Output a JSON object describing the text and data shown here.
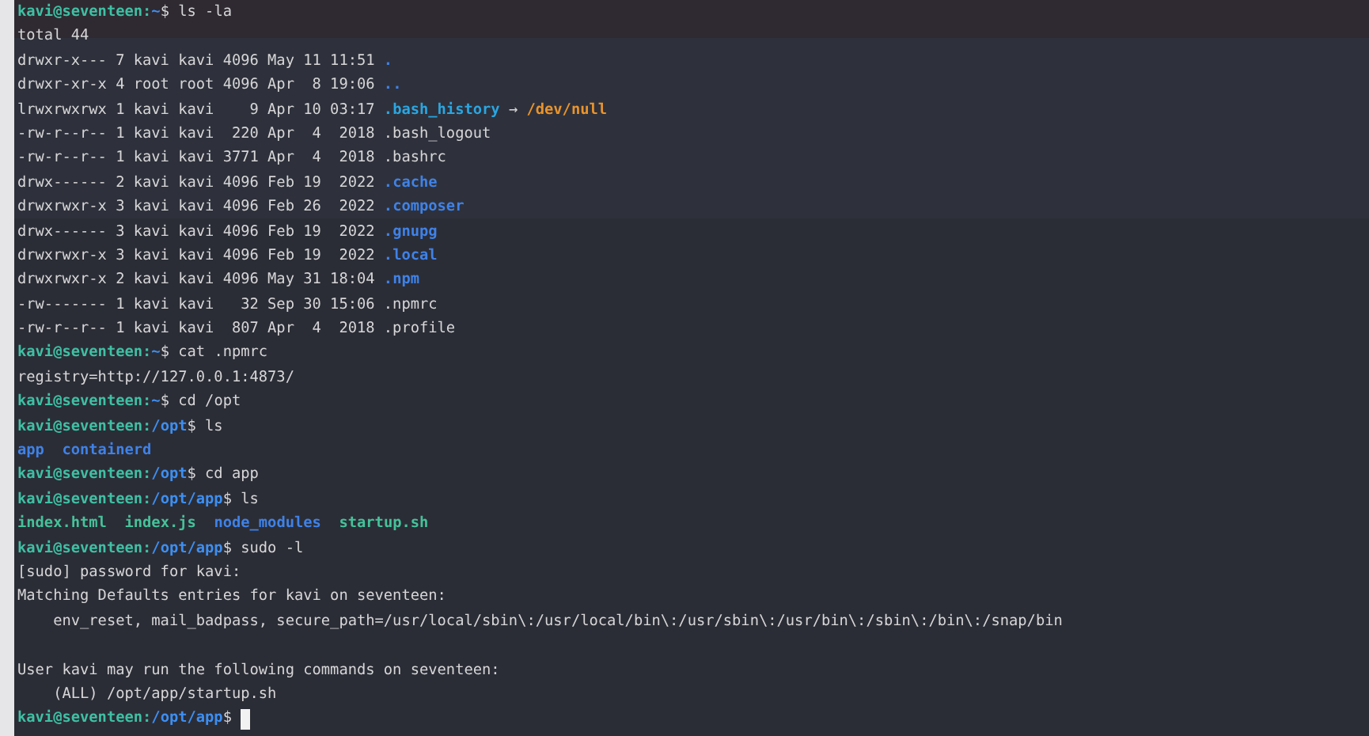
{
  "terminal": {
    "lines": [
      {
        "segments": [
          {
            "kind": "userhost",
            "text": "kavi@seventeen:"
          },
          {
            "kind": "path",
            "text": "~"
          },
          {
            "kind": "plain",
            "text": "$ ls -la"
          }
        ]
      },
      {
        "segments": [
          {
            "kind": "plain",
            "text": "total 44"
          }
        ]
      },
      {
        "segments": [
          {
            "kind": "plain",
            "text": "drwxr-x--- 7 kavi kavi 4096 May 11 11:51 "
          },
          {
            "kind": "dir",
            "text": "."
          }
        ]
      },
      {
        "segments": [
          {
            "kind": "plain",
            "text": "drwxr-xr-x 4 root root 4096 Apr  8 19:06 "
          },
          {
            "kind": "dir",
            "text": ".."
          }
        ]
      },
      {
        "segments": [
          {
            "kind": "plain",
            "text": "lrwxrwxrwx 1 kavi kavi    9 Apr 10 03:17 "
          },
          {
            "kind": "link",
            "text": ".bash_history"
          },
          {
            "kind": "plain",
            "text": " → "
          },
          {
            "kind": "target",
            "text": "/dev/null"
          }
        ]
      },
      {
        "segments": [
          {
            "kind": "plain",
            "text": "-rw-r--r-- 1 kavi kavi  220 Apr  4  2018 .bash_logout"
          }
        ]
      },
      {
        "segments": [
          {
            "kind": "plain",
            "text": "-rw-r--r-- 1 kavi kavi 3771 Apr  4  2018 .bashrc"
          }
        ]
      },
      {
        "segments": [
          {
            "kind": "plain",
            "text": "drwx------ 2 kavi kavi 4096 Feb 19  2022 "
          },
          {
            "kind": "dir",
            "text": ".cache"
          }
        ]
      },
      {
        "segments": [
          {
            "kind": "plain",
            "text": "drwxrwxr-x 3 kavi kavi 4096 Feb 26  2022 "
          },
          {
            "kind": "dir",
            "text": ".composer"
          }
        ]
      },
      {
        "segments": [
          {
            "kind": "plain",
            "text": "drwx------ 3 kavi kavi 4096 Feb 19  2022 "
          },
          {
            "kind": "dir",
            "text": ".gnupg"
          }
        ]
      },
      {
        "segments": [
          {
            "kind": "plain",
            "text": "drwxrwxr-x 3 kavi kavi 4096 Feb 19  2022 "
          },
          {
            "kind": "dir",
            "text": ".local"
          }
        ]
      },
      {
        "segments": [
          {
            "kind": "plain",
            "text": "drwxrwxr-x 2 kavi kavi 4096 May 31 18:04 "
          },
          {
            "kind": "dir",
            "text": ".npm"
          }
        ]
      },
      {
        "segments": [
          {
            "kind": "plain",
            "text": "-rw------- 1 kavi kavi   32 Sep 30 15:06 .npmrc"
          }
        ]
      },
      {
        "segments": [
          {
            "kind": "plain",
            "text": "-rw-r--r-- 1 kavi kavi  807 Apr  4  2018 .profile"
          }
        ]
      },
      {
        "segments": [
          {
            "kind": "userhost",
            "text": "kavi@seventeen:"
          },
          {
            "kind": "path",
            "text": "~"
          },
          {
            "kind": "plain",
            "text": "$ cat .npmrc"
          }
        ]
      },
      {
        "segments": [
          {
            "kind": "plain",
            "text": "registry=http://127.0.0.1:4873/"
          }
        ]
      },
      {
        "segments": [
          {
            "kind": "userhost",
            "text": "kavi@seventeen:"
          },
          {
            "kind": "path",
            "text": "~"
          },
          {
            "kind": "plain",
            "text": "$ cd /opt"
          }
        ]
      },
      {
        "segments": [
          {
            "kind": "userhost",
            "text": "kavi@seventeen:"
          },
          {
            "kind": "path",
            "text": "/opt"
          },
          {
            "kind": "plain",
            "text": "$ ls"
          }
        ]
      },
      {
        "segments": [
          {
            "kind": "dir",
            "text": "app"
          },
          {
            "kind": "dir",
            "text": "  containerd"
          }
        ]
      },
      {
        "segments": [
          {
            "kind": "userhost",
            "text": "kavi@seventeen:"
          },
          {
            "kind": "path",
            "text": "/opt"
          },
          {
            "kind": "plain",
            "text": "$ cd app"
          }
        ]
      },
      {
        "segments": [
          {
            "kind": "userhost",
            "text": "kavi@seventeen:"
          },
          {
            "kind": "path",
            "text": "/opt/app"
          },
          {
            "kind": "plain",
            "text": "$ ls"
          }
        ]
      },
      {
        "segments": [
          {
            "kind": "exec",
            "text": "index.html"
          },
          {
            "kind": "exec",
            "text": "  index.js"
          },
          {
            "kind": "dir",
            "text": "  node_modules"
          },
          {
            "kind": "exec",
            "text": "  startup.sh"
          }
        ]
      },
      {
        "segments": [
          {
            "kind": "userhost",
            "text": "kavi@seventeen:"
          },
          {
            "kind": "path",
            "text": "/opt/app"
          },
          {
            "kind": "plain",
            "text": "$ sudo -l"
          }
        ]
      },
      {
        "segments": [
          {
            "kind": "plain",
            "text": "[sudo] password for kavi:"
          }
        ]
      },
      {
        "segments": [
          {
            "kind": "plain",
            "text": "Matching Defaults entries for kavi on seventeen:"
          }
        ]
      },
      {
        "segments": [
          {
            "kind": "plain",
            "text": "    env_reset, mail_badpass, secure_path=/usr/local/sbin\\:/usr/local/bin\\:/usr/sbin\\:/usr/bin\\:/sbin\\:/bin\\:/snap/bin"
          }
        ]
      },
      {
        "blank_line_before": true,
        "segments": [
          {
            "kind": "plain",
            "text": "User kavi may run the following commands on seventeen:"
          }
        ]
      },
      {
        "segments": [
          {
            "kind": "plain",
            "text": "    (ALL) /opt/app/startup.sh"
          }
        ]
      },
      {
        "segments": [
          {
            "kind": "userhost",
            "text": "kavi@seventeen:"
          },
          {
            "kind": "path",
            "text": "/opt/app"
          },
          {
            "kind": "plain",
            "text": "$ "
          }
        ],
        "cursor": true
      }
    ]
  }
}
